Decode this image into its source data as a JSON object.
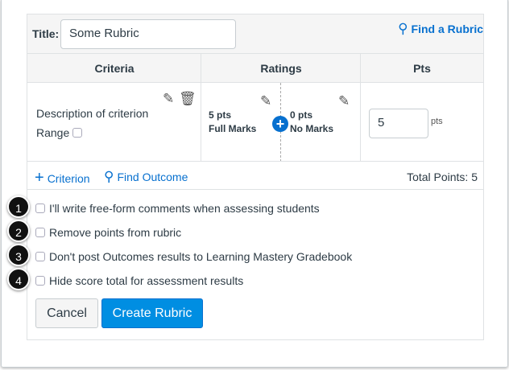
{
  "title_label": "Title:",
  "title_value": "Some Rubric",
  "find_rubric": "Find a Rubric",
  "columns": [
    "Criteria",
    "Ratings",
    "Pts"
  ],
  "criterion": {
    "description": "Description of criterion",
    "range_label": "Range",
    "points": "5",
    "pts_unit": "pts"
  },
  "ratings": [
    {
      "points": "5 pts",
      "label": "Full Marks"
    },
    {
      "points": "0 pts",
      "label": "No Marks"
    }
  ],
  "footer": {
    "add_criterion": "Criterion",
    "find_outcome": "Find Outcome",
    "total": "Total Points: 5"
  },
  "options": [
    {
      "num": "1",
      "label": "I'll write free-form comments when assessing students"
    },
    {
      "num": "2",
      "label": "Remove points from rubric"
    },
    {
      "num": "3",
      "label": "Don't post Outcomes results to Learning Mastery Gradebook"
    },
    {
      "num": "4",
      "label": "Hide score total for assessment results"
    }
  ],
  "buttons": {
    "cancel": "Cancel",
    "create": "Create Rubric"
  },
  "colors": {
    "accent": "#0770cf",
    "primary": "#008ee2"
  }
}
